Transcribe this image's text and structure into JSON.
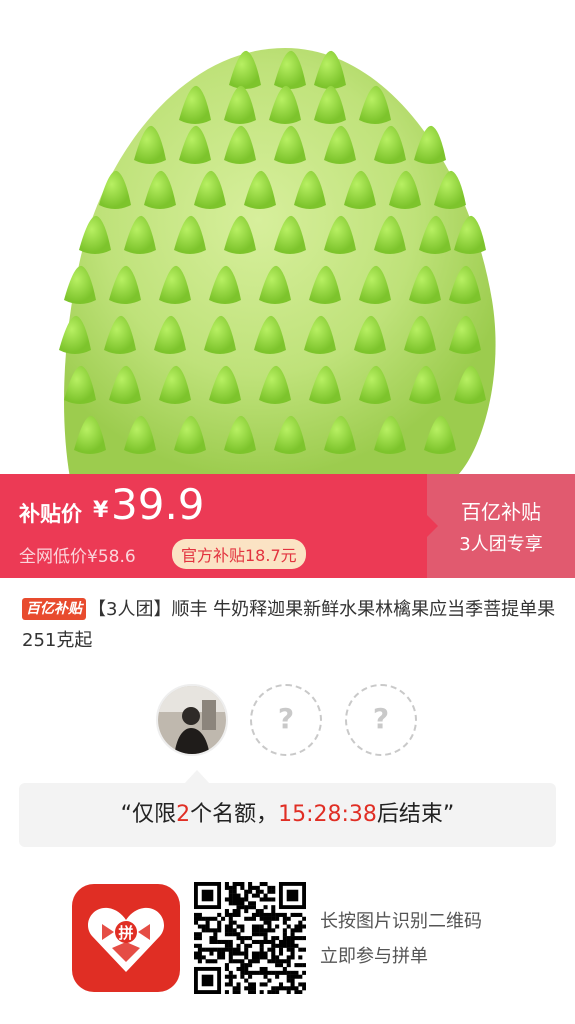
{
  "product_image": {
    "icon": "soursop-fruit-image"
  },
  "price_bar": {
    "subsidy_label": "补贴价",
    "currency": "¥",
    "price": "39.9",
    "market_label": "全网低价",
    "market_price": "¥58.6",
    "badge": "官方补贴18.7元",
    "campaign": "百亿补贴",
    "group_info": "3人团专享",
    "colors": {
      "left_bg": "#ec3a55",
      "right_bg": "#e15a6f",
      "badge_bg": "#fbe3c4"
    }
  },
  "product": {
    "tag": "百亿补贴",
    "title": "【3人团】顺丰 牛奶释迦果新鲜水果林檎果应当季菩提单果251克起"
  },
  "group": {
    "slots": [
      {
        "type": "member",
        "icon": "user-avatar"
      },
      {
        "type": "empty",
        "placeholder": "?"
      },
      {
        "type": "empty",
        "placeholder": "?"
      }
    ]
  },
  "countdown": {
    "open_quote": "“",
    "prefix": "仅限",
    "count": "2",
    "mid": "个名额，",
    "time": "15:28:38",
    "suffix": "后结束",
    "close_quote": "”"
  },
  "footer": {
    "app_logo": "pinduoduo-logo-icon",
    "logo_text": "拼",
    "qr": "qr-code",
    "hint_line1": "长按图片识别二维码",
    "hint_line2": "立即参与拼单"
  }
}
